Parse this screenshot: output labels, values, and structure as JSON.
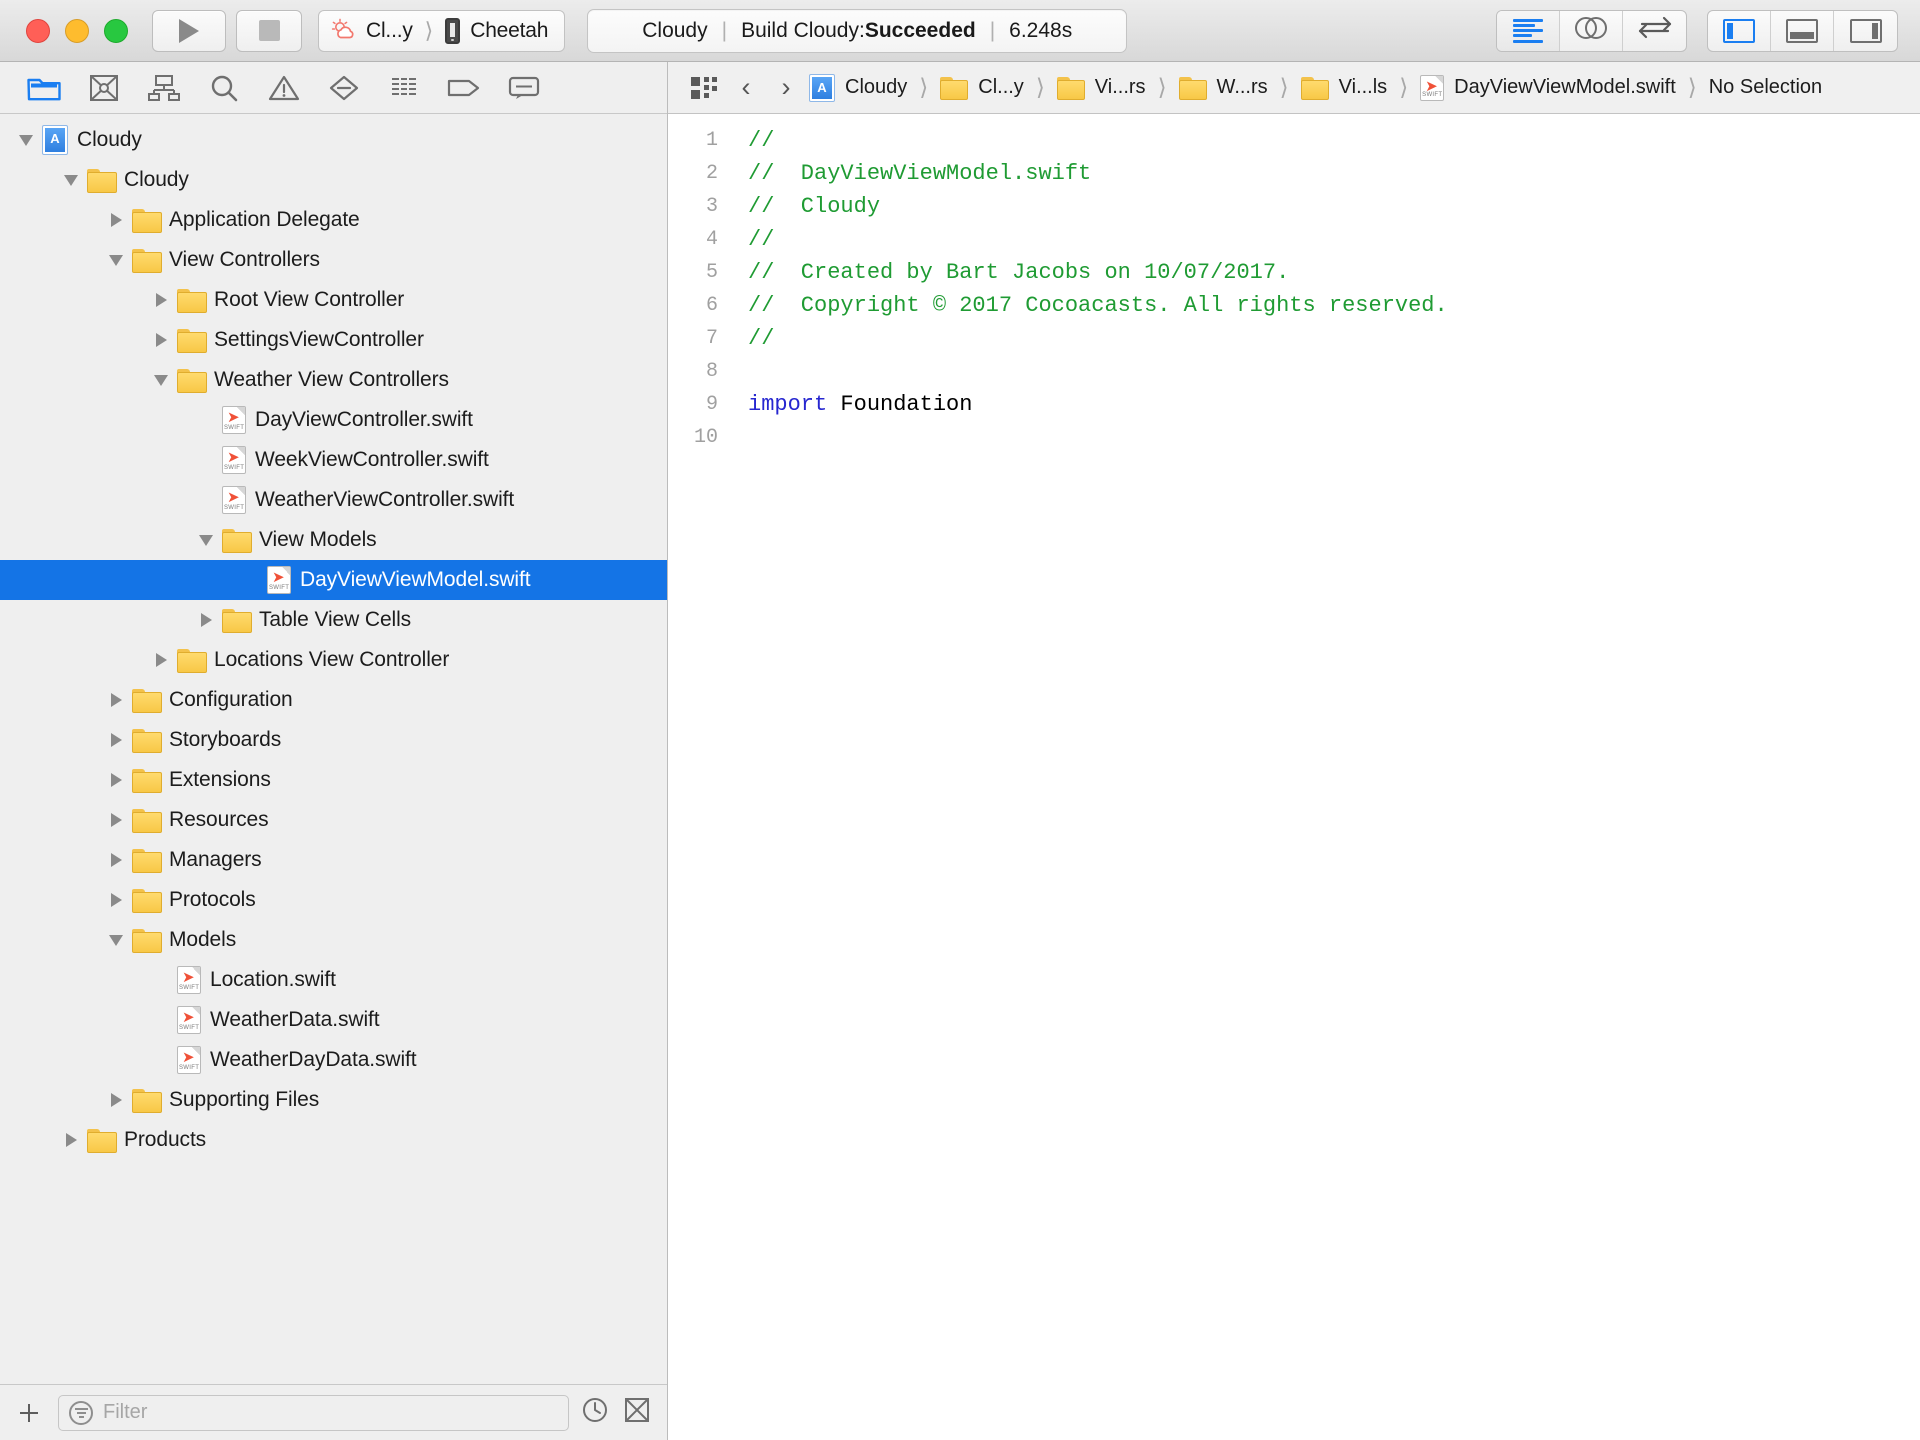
{
  "window": {
    "traffic_lights": [
      "close",
      "minimize",
      "zoom"
    ]
  },
  "toolbar": {
    "run_label": "Run",
    "stop_label": "Stop",
    "scheme": "Cl...y",
    "device": "Cheetah",
    "status": {
      "project": "Cloudy",
      "separator": "|",
      "build_prefix": "Build Cloudy: ",
      "build_result": "Succeeded",
      "duration": "6.248s"
    },
    "right_buttons": [
      {
        "name": "standard-editor",
        "label": "Standard Editor",
        "active": true
      },
      {
        "name": "assistant-editor",
        "label": "Assistant Editor",
        "active": false
      },
      {
        "name": "version-editor",
        "label": "Version Editor",
        "active": false
      }
    ],
    "pane_buttons": [
      {
        "name": "navigator-toggle",
        "label": "Hide or show the Navigator",
        "active": true
      },
      {
        "name": "debug-toggle",
        "label": "Hide or show the Debug area",
        "active": false
      },
      {
        "name": "utilities-toggle",
        "label": "Hide or show the Utilities",
        "active": false
      }
    ]
  },
  "navigator": {
    "tabs": [
      {
        "name": "project-navigator",
        "label": "Project",
        "active": true
      },
      {
        "name": "source-control-navigator",
        "label": "Source Control",
        "active": false
      },
      {
        "name": "symbol-navigator",
        "label": "Symbol",
        "active": false
      },
      {
        "name": "find-navigator",
        "label": "Find",
        "active": false
      },
      {
        "name": "issue-navigator",
        "label": "Issue",
        "active": false
      },
      {
        "name": "test-navigator",
        "label": "Test",
        "active": false
      },
      {
        "name": "debug-navigator",
        "label": "Debug",
        "active": false
      },
      {
        "name": "breakpoint-navigator",
        "label": "Breakpoint",
        "active": false
      },
      {
        "name": "report-navigator",
        "label": "Report",
        "active": false
      }
    ],
    "tree": [
      {
        "label": "Cloudy",
        "icon": "project",
        "indent": 0,
        "disclosure": "open",
        "selected": false
      },
      {
        "label": "Cloudy",
        "icon": "folder",
        "indent": 1,
        "disclosure": "open",
        "selected": false
      },
      {
        "label": "Application Delegate",
        "icon": "folder",
        "indent": 2,
        "disclosure": "closed",
        "selected": false
      },
      {
        "label": "View Controllers",
        "icon": "folder",
        "indent": 2,
        "disclosure": "open",
        "selected": false
      },
      {
        "label": "Root View Controller",
        "icon": "folder",
        "indent": 3,
        "disclosure": "closed",
        "selected": false
      },
      {
        "label": "SettingsViewController",
        "icon": "folder",
        "indent": 3,
        "disclosure": "closed",
        "selected": false
      },
      {
        "label": "Weather View Controllers",
        "icon": "folder",
        "indent": 3,
        "disclosure": "open",
        "selected": false
      },
      {
        "label": "DayViewController.swift",
        "icon": "swift",
        "indent": 4,
        "disclosure": "none",
        "selected": false
      },
      {
        "label": "WeekViewController.swift",
        "icon": "swift",
        "indent": 4,
        "disclosure": "none",
        "selected": false
      },
      {
        "label": "WeatherViewController.swift",
        "icon": "swift",
        "indent": 4,
        "disclosure": "none",
        "selected": false
      },
      {
        "label": "View Models",
        "icon": "folder",
        "indent": 4,
        "disclosure": "open",
        "selected": false
      },
      {
        "label": "DayViewViewModel.swift",
        "icon": "swift",
        "indent": 5,
        "disclosure": "none",
        "selected": true
      },
      {
        "label": "Table View Cells",
        "icon": "folder",
        "indent": 4,
        "disclosure": "closed",
        "selected": false
      },
      {
        "label": "Locations View Controller",
        "icon": "folder",
        "indent": 3,
        "disclosure": "closed",
        "selected": false
      },
      {
        "label": "Configuration",
        "icon": "folder",
        "indent": 2,
        "disclosure": "closed",
        "selected": false
      },
      {
        "label": "Storyboards",
        "icon": "folder",
        "indent": 2,
        "disclosure": "closed",
        "selected": false
      },
      {
        "label": "Extensions",
        "icon": "folder",
        "indent": 2,
        "disclosure": "closed",
        "selected": false
      },
      {
        "label": "Resources",
        "icon": "folder",
        "indent": 2,
        "disclosure": "closed",
        "selected": false
      },
      {
        "label": "Managers",
        "icon": "folder",
        "indent": 2,
        "disclosure": "closed",
        "selected": false
      },
      {
        "label": "Protocols",
        "icon": "folder",
        "indent": 2,
        "disclosure": "closed",
        "selected": false
      },
      {
        "label": "Models",
        "icon": "folder",
        "indent": 2,
        "disclosure": "open",
        "selected": false
      },
      {
        "label": "Location.swift",
        "icon": "swift",
        "indent": 3,
        "disclosure": "none",
        "selected": false
      },
      {
        "label": "WeatherData.swift",
        "icon": "swift",
        "indent": 3,
        "disclosure": "none",
        "selected": false
      },
      {
        "label": "WeatherDayData.swift",
        "icon": "swift",
        "indent": 3,
        "disclosure": "none",
        "selected": false
      },
      {
        "label": "Supporting Files",
        "icon": "folder",
        "indent": 2,
        "disclosure": "closed",
        "selected": false
      },
      {
        "label": "Products",
        "icon": "folder",
        "indent": 1,
        "disclosure": "closed",
        "selected": false
      }
    ],
    "filter": {
      "placeholder": "Filter",
      "add_label": "+",
      "recent_label": "Show only recent files",
      "unsaved_label": "Show only files with source-control status"
    }
  },
  "editor": {
    "breadcrumb": [
      {
        "label": "Cloudy",
        "icon": "project"
      },
      {
        "label": "Cl...y",
        "icon": "folder"
      },
      {
        "label": "Vi...rs",
        "icon": "folder"
      },
      {
        "label": "W...rs",
        "icon": "folder"
      },
      {
        "label": "Vi...ls",
        "icon": "folder"
      },
      {
        "label": "DayViewViewModel.swift",
        "icon": "swift"
      },
      {
        "label": "No Selection",
        "icon": "none"
      }
    ],
    "back_label": "‹",
    "forward_label": "›",
    "code": {
      "lines": [
        {
          "n": "1",
          "tokens": [
            {
              "t": "//",
              "c": "cm"
            }
          ]
        },
        {
          "n": "2",
          "tokens": [
            {
              "t": "//  DayViewViewModel.swift",
              "c": "cm"
            }
          ]
        },
        {
          "n": "3",
          "tokens": [
            {
              "t": "//  Cloudy",
              "c": "cm"
            }
          ]
        },
        {
          "n": "4",
          "tokens": [
            {
              "t": "//",
              "c": "cm"
            }
          ]
        },
        {
          "n": "5",
          "tokens": [
            {
              "t": "//  Created by Bart Jacobs on 10/07/2017.",
              "c": "cm"
            }
          ]
        },
        {
          "n": "6",
          "tokens": [
            {
              "t": "//  Copyright © 2017 Cocoacasts. All rights reserved.",
              "c": "cm"
            }
          ]
        },
        {
          "n": "7",
          "tokens": [
            {
              "t": "//",
              "c": "cm"
            }
          ]
        },
        {
          "n": "8",
          "tokens": []
        },
        {
          "n": "9",
          "tokens": [
            {
              "t": "import",
              "c": "kw"
            },
            {
              "t": " Foundation",
              "c": "pl"
            }
          ]
        },
        {
          "n": "10",
          "tokens": []
        }
      ]
    }
  },
  "colors": {
    "selection_blue": "#1474e6",
    "comment_green": "#1f9b33",
    "keyword_blue": "#2727d0",
    "accent_blue": "#1a7ef1",
    "folder_yellow": "#f8c846",
    "swift_orange": "#f05138"
  }
}
